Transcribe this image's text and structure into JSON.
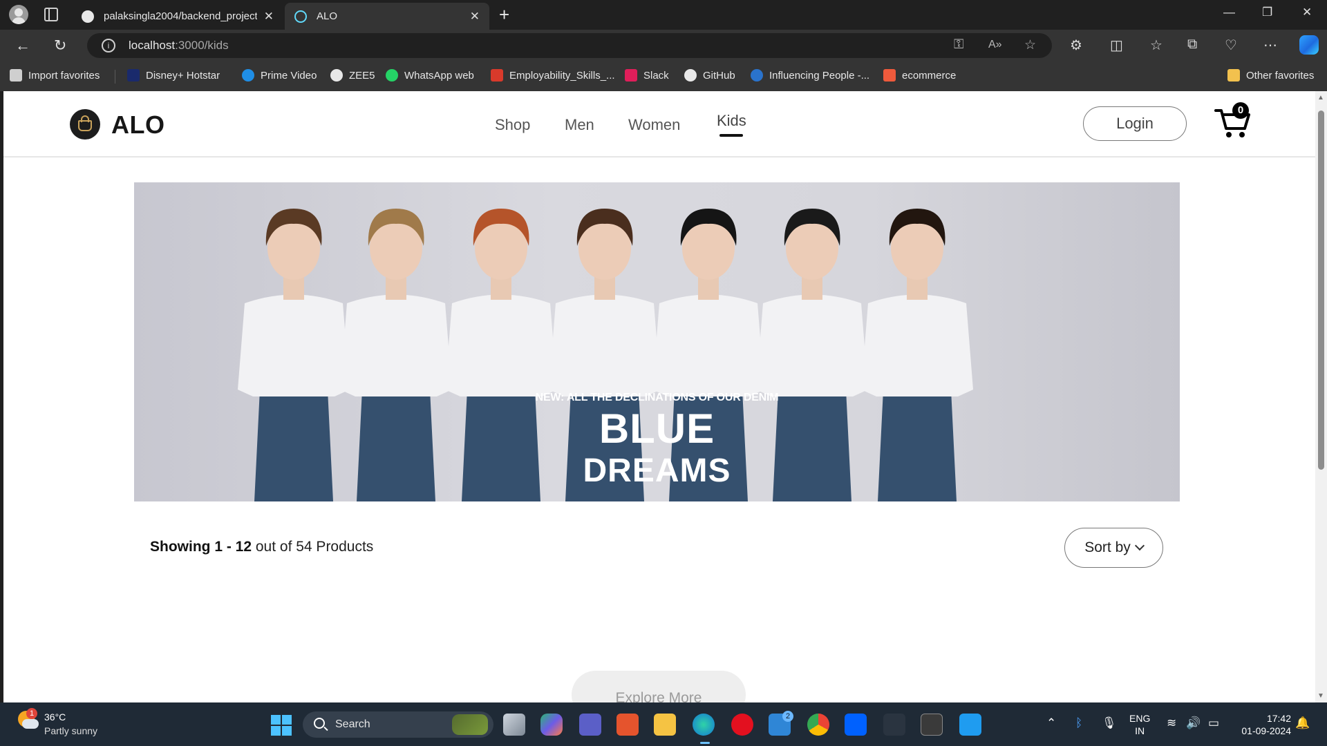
{
  "browser": {
    "tabs": [
      {
        "title": "palaksingla2004/backend_project",
        "icon": "github-icon"
      },
      {
        "title": "ALO",
        "icon": "react-icon",
        "active": true
      }
    ],
    "url_host": "localhost",
    "url_path": ":3000/kids",
    "favorites": [
      {
        "label": "Import favorites",
        "icon": "import-icon",
        "color": "#cfcfcf"
      },
      {
        "label": "Disney+ Hotstar",
        "icon": "hotstar-icon",
        "color": "#1a2a6c"
      },
      {
        "label": "Prime Video",
        "icon": "prime-video-icon",
        "color": "#1f8ee6"
      },
      {
        "label": "ZEE5",
        "icon": "zee5-icon",
        "color": "#e8e8e8"
      },
      {
        "label": "WhatsApp web",
        "icon": "whatsapp-icon",
        "color": "#25d366"
      },
      {
        "label": "Employability_Skills_...",
        "icon": "pdf-icon",
        "color": "#d93a2b"
      },
      {
        "label": "Slack",
        "icon": "slack-icon",
        "color": "#e01e5a"
      },
      {
        "label": "GitHub",
        "icon": "github-icon",
        "color": "#e8e8e8"
      },
      {
        "label": "Influencing People -...",
        "icon": "coursera-icon",
        "color": "#2a73cc"
      },
      {
        "label": "ecommerce",
        "icon": "ecommerce-icon",
        "color": "#ef5a3c"
      }
    ],
    "other_favorites": "Other favorites"
  },
  "site": {
    "brand": "ALO",
    "nav": [
      {
        "label": "Shop",
        "active": false
      },
      {
        "label": "Men",
        "active": false
      },
      {
        "label": "Women",
        "active": false
      },
      {
        "label": "Kids",
        "active": true
      }
    ],
    "login_label": "Login",
    "cart_count": "0"
  },
  "hero": {
    "subtitle": "NEW: ALL THE DECLINATIONS OF OUR DENIM",
    "title_line1": "BLUE",
    "title_line2": "DREAMS"
  },
  "listing": {
    "showing_bold": "Showing 1 - 12",
    "showing_rest": " out of 54 Products",
    "sort_label": "Sort by",
    "explore_label": "Explore More"
  },
  "taskbar": {
    "weather_badge": "1",
    "temperature": "36°C",
    "weather": "Partly sunny",
    "search_label": "Search",
    "mail_badge": "2",
    "lang_line1": "ENG",
    "lang_line2": "IN",
    "time": "17:42",
    "date": "01-09-2024"
  },
  "colors": {
    "accent": "#111111",
    "taskbar": "#1f2a36",
    "hero_bg": "#d6d6dc"
  }
}
